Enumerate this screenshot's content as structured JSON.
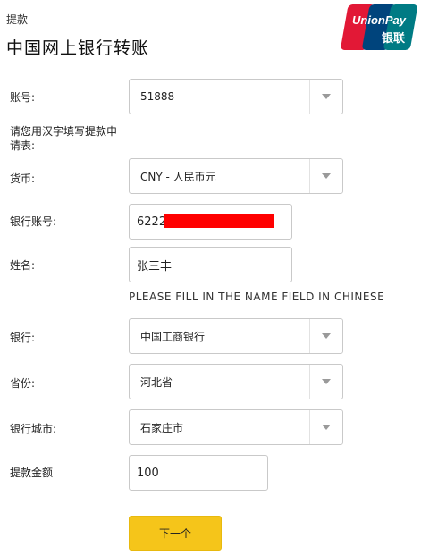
{
  "header": {
    "breadcrumb": "提款",
    "title": "中国网上银行转账",
    "logo": {
      "text_top": "UnionPay",
      "text_bottom": "银联"
    }
  },
  "form": {
    "account": {
      "label": "账号:",
      "value": "51888"
    },
    "note": "请您用汉字填写提款申请表:",
    "currency": {
      "label": "货币:",
      "value": "CNY - 人民币元"
    },
    "bank_account": {
      "label": "银行账号:",
      "value": "6222"
    },
    "name": {
      "label": "姓名:",
      "value": "张三丰",
      "hint": "PLEASE FILL IN THE NAME FIELD IN CHINESE"
    },
    "bank": {
      "label": "银行:",
      "value": "中国工商银行"
    },
    "province": {
      "label": "省份:",
      "value": "河北省"
    },
    "city": {
      "label": "银行城市:",
      "value": "石家庄市"
    },
    "amount": {
      "label": "提款金额",
      "value": "100"
    },
    "next_button": "下一个"
  },
  "colors": {
    "button": "#f5c51a",
    "redaction": "#ff0000",
    "unionpay_red": "#e21836",
    "unionpay_blue": "#00447c",
    "unionpay_teal": "#007b84"
  },
  "icons": {
    "select_caret": "chevron-down-icon",
    "logo": "unionpay-logo"
  }
}
